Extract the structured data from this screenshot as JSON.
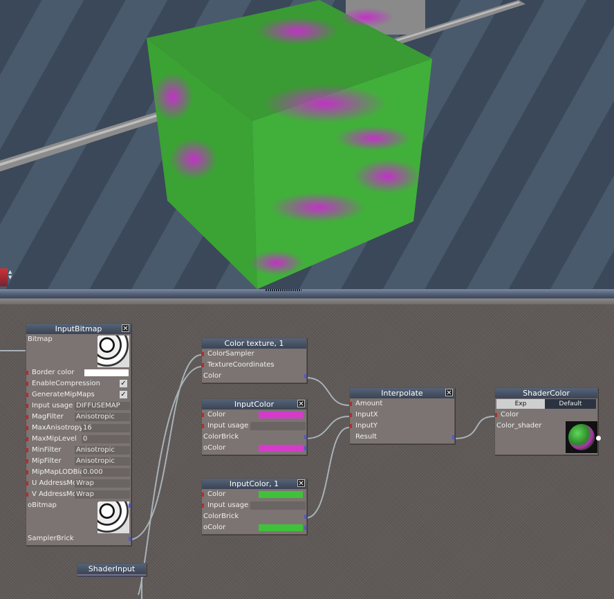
{
  "colors": {
    "magenta": "#d53bcb",
    "green": "#3fc23a",
    "border_white": "#ffffff"
  },
  "viewport": {
    "toolbar_icons": [
      "texture-icon",
      "arrow-up-icon",
      "arrow-down-icon"
    ]
  },
  "nodes": {
    "input_bitmap": {
      "title": "InputBitmap",
      "close": "✕",
      "bitmap": "Bitmap",
      "border_color": "Border color",
      "enable_compression": "EnableCompression",
      "check1": "✓",
      "generate_mipmaps": "GenerateMipMaps",
      "check2": "✓",
      "input_usage": "Input usage",
      "input_usage_val": "DIFFUSEMAP",
      "mag_filter": "MagFilter",
      "mag_filter_val": "Anisotropic",
      "max_aniso": "MaxAnisotropy",
      "max_aniso_val": "16",
      "max_mip": "MaxMipLevel",
      "max_mip_val": "0",
      "min_filter": "MinFilter",
      "min_filter_val": "Anisotropic",
      "mip_filter": "MipFilter",
      "mip_filter_val": "Anisotropic",
      "lod_bias": "MipMapLODBias",
      "lod_bias_val": "0.000",
      "u_addr": "U  AddressMode",
      "u_addr_val": "Wrap",
      "v_addr": "V  AddressMode",
      "v_addr_val": "Wrap",
      "obitmap": "oBitmap",
      "sampler_brick": "SamplerBrick"
    },
    "color_texture": {
      "title": "Color texture, 1",
      "color_sampler": "ColorSampler",
      "texture_coords": "TextureCoordinates",
      "color": "Color"
    },
    "input_color": {
      "title": "InputColor",
      "close": "✕",
      "color": "Color",
      "input_usage": "Input usage",
      "color_brick": "ColorBrick",
      "ocolor": "oColor"
    },
    "input_color_1": {
      "title": "InputColor, 1",
      "close": "✕",
      "color": "Color",
      "input_usage": "Input usage",
      "color_brick": "ColorBrick",
      "ocolor": "oColor"
    },
    "interpolate": {
      "title": "Interpolate",
      "close": "✕",
      "amount": "Amount",
      "input_x": "InputX",
      "input_y": "InputY",
      "result": "Result"
    },
    "shader_color": {
      "title": "ShaderColor",
      "tab_exp": "Exp",
      "tab_default": "Default",
      "color": "Color",
      "color_shader": "Color_shader"
    },
    "shader_input": {
      "title": "ShaderInput"
    }
  }
}
